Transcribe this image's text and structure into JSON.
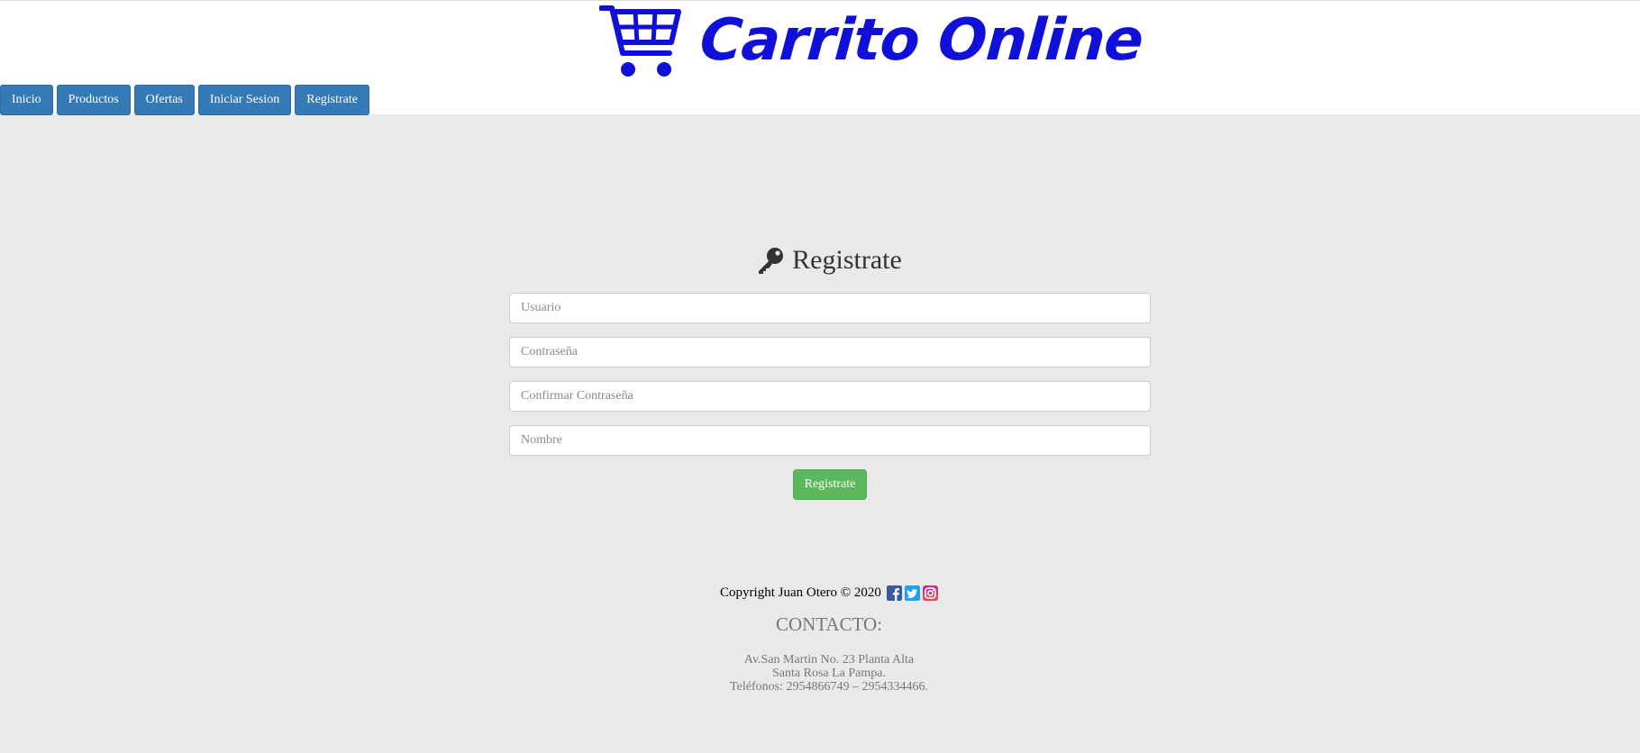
{
  "brand": {
    "name": "Carrito Online",
    "logo_icon": "shopping-cart-icon",
    "color": "#1010d8"
  },
  "nav": {
    "items": [
      {
        "label": "Inicio"
      },
      {
        "label": "Productos"
      },
      {
        "label": "Ofertas"
      },
      {
        "label": "Iniciar Sesion"
      },
      {
        "label": "Registrate"
      }
    ],
    "color": "#337ab7"
  },
  "form": {
    "title": "Registrate",
    "title_icon": "key-icon",
    "fields": {
      "usuario": {
        "placeholder": "Usuario",
        "value": ""
      },
      "contrasena": {
        "placeholder": "Contraseña",
        "value": ""
      },
      "confirmar": {
        "placeholder": "Confirmar Contraseña",
        "value": ""
      },
      "nombre": {
        "placeholder": "Nombre",
        "value": ""
      }
    },
    "submit_label": "Registrate",
    "submit_color": "#5cb85c"
  },
  "footer": {
    "copyright": "Copyright Juan Otero © 2020",
    "social_icons": [
      "facebook-icon",
      "twitter-icon",
      "instagram-icon"
    ],
    "contact_title": "CONTACTO:",
    "address_line1": "Av.San Martin No. 23 Planta Alta",
    "address_line2": "Santa Rosa La Pampa.",
    "phones": "Teléfonos: 2954866749 – 2954334466."
  }
}
